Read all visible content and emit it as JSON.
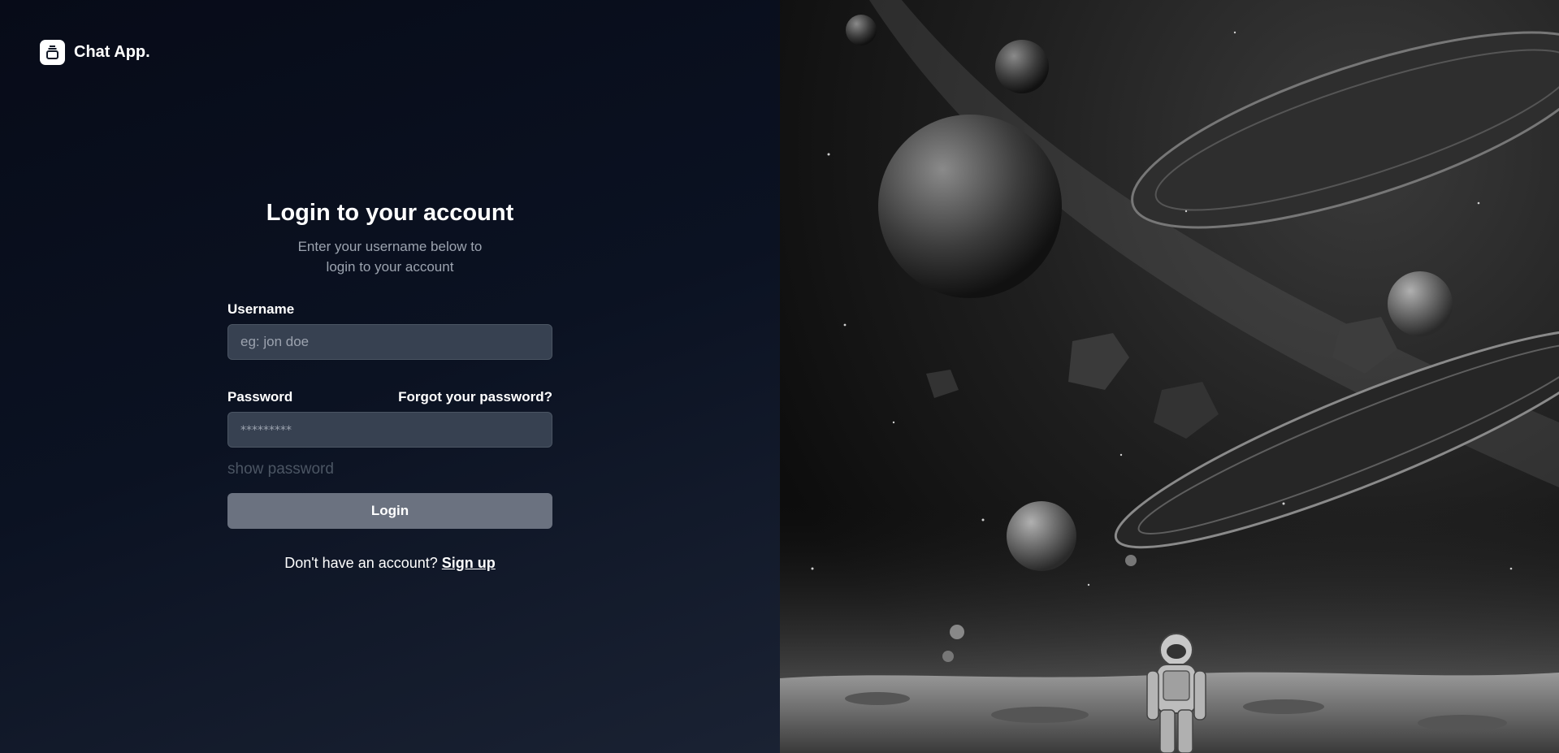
{
  "brand": {
    "name": "Chat App.",
    "icon": "chat-stack-icon"
  },
  "login": {
    "title": "Login to your account",
    "subtitle": "Enter your username below to login to your account",
    "username_label": "Username",
    "username_placeholder": "eg: jon doe",
    "password_label": "Password",
    "forgot_label": "Forgot your password?",
    "password_placeholder": "*********",
    "show_password_label": "show password",
    "login_button": "Login",
    "signup_prompt": "Don't have an account?",
    "signup_link": "Sign up"
  },
  "hero": {
    "description_icon": "space-scene-illustration"
  },
  "colors": {
    "input_bg": "#374151",
    "button_bg": "#6b7280",
    "muted_text": "#9ca3af"
  }
}
